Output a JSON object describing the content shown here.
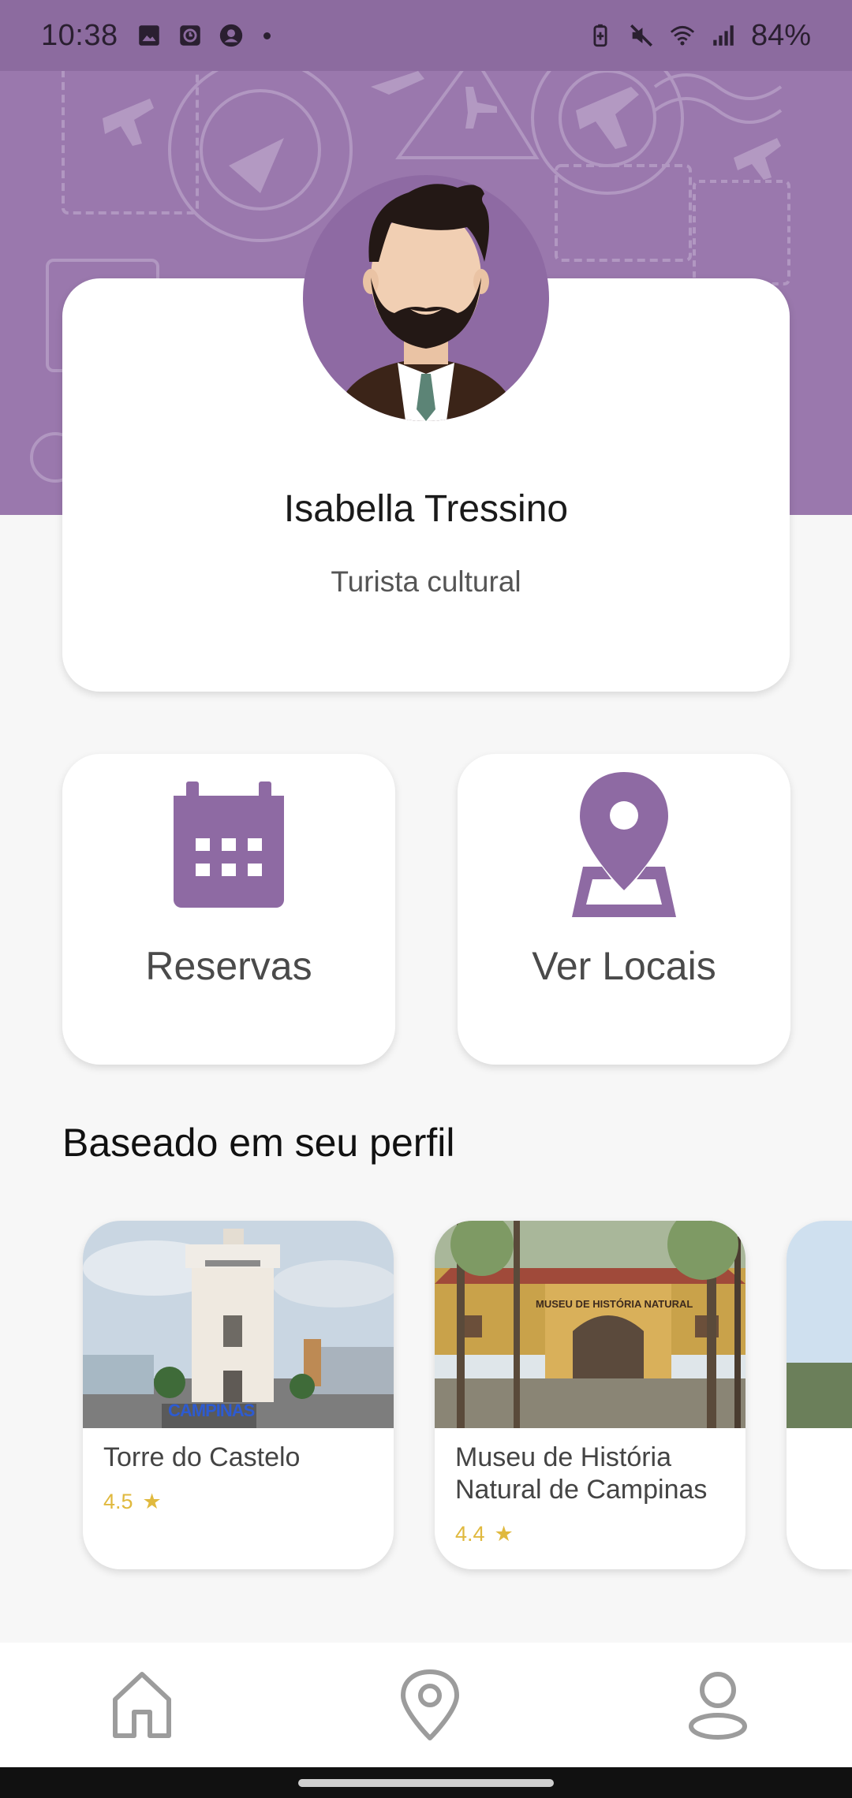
{
  "status_bar": {
    "time": "10:38",
    "battery": "84%",
    "left_icons": [
      "image-icon",
      "clock-app-icon",
      "account-icon",
      "dot-icon"
    ],
    "right_icons": [
      "battery-saver-icon",
      "mute-icon",
      "wifi-icon",
      "signal-icon"
    ]
  },
  "profile": {
    "name": "Isabella Tressino",
    "subtitle": "Turista cultural"
  },
  "actions": [
    {
      "label": "Reservas",
      "icon": "calendar-icon"
    },
    {
      "label": "Ver Locais",
      "icon": "map-pin-icon"
    }
  ],
  "recommendations": {
    "section_title": "Baseado em seu perfil",
    "items": [
      {
        "title": "Torre do Castelo",
        "rating": "4.5",
        "image_text": "CAMPINAS"
      },
      {
        "title": "Museu de História Natural de Campinas",
        "rating": "4.4",
        "image_text": "MUSEU DE HISTÓRIA NATURAL"
      }
    ]
  },
  "bottom_nav": [
    "home-icon",
    "location-icon",
    "profile-icon"
  ],
  "colors": {
    "primary": "#8e6aa3",
    "header": "#9a78ad",
    "rating": "#e0b93e",
    "background": "#f7f7f7"
  }
}
